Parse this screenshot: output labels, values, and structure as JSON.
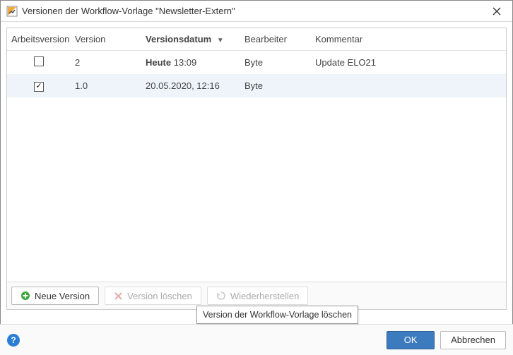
{
  "window": {
    "title": "Versionen der Workflow-Vorlage \"Newsletter-Extern\""
  },
  "table": {
    "columns": {
      "work_version": "Arbeitsversion",
      "version": "Version",
      "version_date": "Versionsdatum",
      "editor": "Bearbeiter",
      "comment": "Kommentar"
    },
    "sort_column": "version_date",
    "sort_dir": "desc",
    "rows": [
      {
        "is_work_version": false,
        "version": "2",
        "date_prefix": "Heute",
        "date_rest": " 13:09",
        "date_full": "Heute 13:09",
        "editor": "Byte",
        "comment": "Update ELO21",
        "selected": false
      },
      {
        "is_work_version": true,
        "version": "1.0",
        "date_prefix": "",
        "date_rest": "20.05.2020, 12:16",
        "date_full": "20.05.2020, 12:16",
        "editor": "Byte",
        "comment": "",
        "selected": true
      }
    ]
  },
  "toolbar": {
    "new_version": "Neue Version",
    "delete_version": "Version löschen",
    "restore": "Wiederherstellen"
  },
  "tooltip": {
    "delete_version": "Version der Workflow-Vorlage löschen"
  },
  "footer": {
    "ok": "OK",
    "cancel": "Abbrechen"
  },
  "colors": {
    "primary": "#3d7bbf",
    "row_selected": "#eef4fa",
    "add_green": "#3aa53a",
    "delete_red": "#c84b4b"
  }
}
